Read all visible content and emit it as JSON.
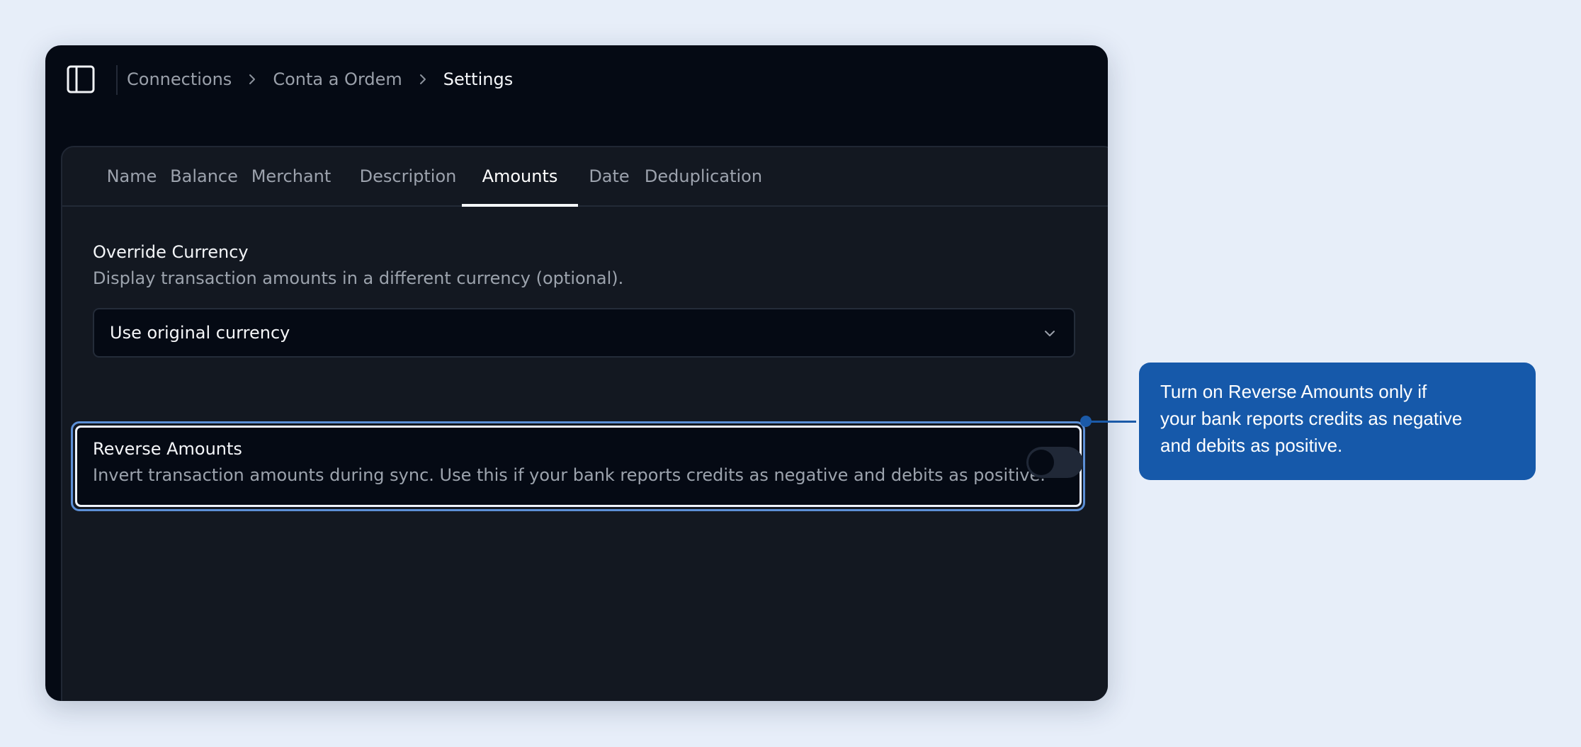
{
  "breadcrumb": {
    "items": [
      "Connections",
      "Conta a Ordem"
    ],
    "current": "Settings"
  },
  "tabs": [
    {
      "label": "Name"
    },
    {
      "label": "Balance"
    },
    {
      "label": "Merchant"
    },
    {
      "label": "Description"
    },
    {
      "label": "Amounts",
      "active": true
    },
    {
      "label": "Date"
    },
    {
      "label": "Deduplication"
    }
  ],
  "override_currency": {
    "title": "Override Currency",
    "description": "Display transaction amounts in a different currency (optional).",
    "selected": "Use original currency"
  },
  "reverse_amounts": {
    "title": "Reverse Amounts",
    "description": "Invert transaction amounts during sync. Use this if your bank reports credits as negative and debits as positive.",
    "enabled": false
  },
  "callout": {
    "text": "Turn on Reverse Amounts only if your bank reports credits as negative and debits as positive."
  },
  "icons": {
    "sidebar_toggle": "sidebar-panel-icon",
    "breadcrumb_separator": "chevron-right-icon",
    "select_arrow": "chevron-down-icon"
  },
  "colors": {
    "page_background": "#e7eef9",
    "window_background": "#050a14",
    "panel_background": "#131821",
    "callout_background": "#1659aa",
    "highlight": "#5c8fd6"
  }
}
